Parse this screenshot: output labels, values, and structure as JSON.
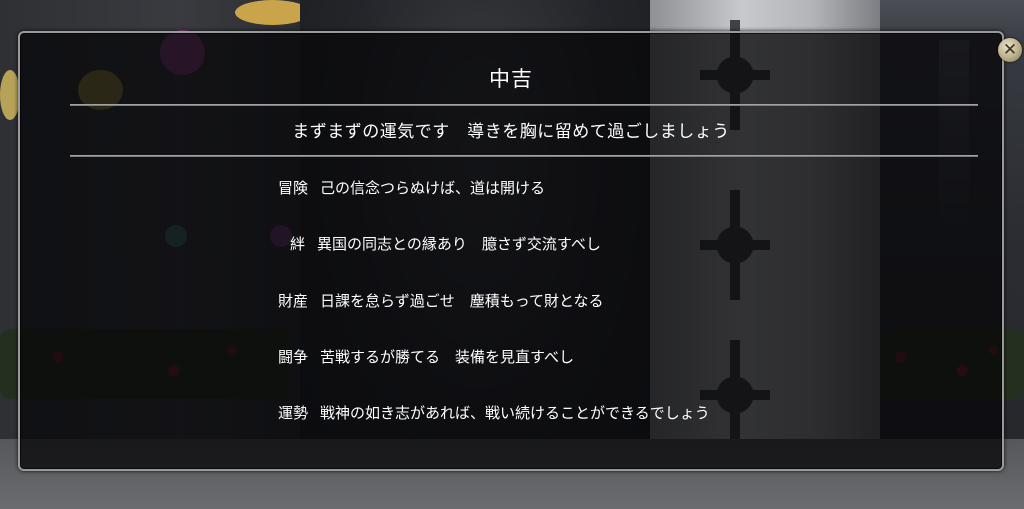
{
  "dialog": {
    "title": "中吉",
    "summary": "まずまずの運気です　導きを胸に留めて過ごしましょう",
    "close_icon": "close-icon",
    "fortunes": [
      {
        "label": "冒険",
        "text": "己の信念つらぬけば、道は開ける"
      },
      {
        "label": "絆",
        "text": "異国の同志との縁あり　臆さず交流すべし"
      },
      {
        "label": "財産",
        "text": "日課を怠らず過ごせ　塵積もって財となる"
      },
      {
        "label": "闘争",
        "text": "苦戦するが勝てる　装備を見直すべし"
      },
      {
        "label": "運勢",
        "text": "戦神の如き志があれば、戦い続けることができるでしょう"
      }
    ]
  },
  "colors": {
    "panel_bg": "#08080a",
    "border": "#9a9a9a",
    "text": "#ffffff"
  }
}
